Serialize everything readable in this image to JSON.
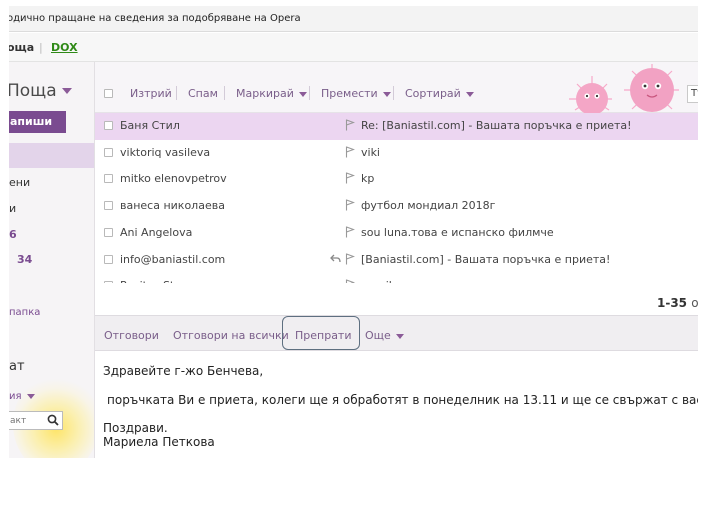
{
  "notice": {
    "text": "одично пращане на сведения за подобряване на Opera"
  },
  "product_bar": {
    "mail_label": "оща",
    "separator": "|",
    "dox_label": "DOX"
  },
  "sidebar": {
    "title": "Поща",
    "compose_label": "апиши",
    "items": [
      {
        "label": "ени"
      },
      {
        "label": "и"
      },
      {
        "label": "6"
      },
      {
        "label": "",
        "count": "34"
      }
    ],
    "new_folder_label": "папка",
    "chat_title": "ат",
    "status_label": "ия",
    "contact_search_placeholder": "акт"
  },
  "toolbar": {
    "delete_label": "Изтрий",
    "spam_label": "Спам",
    "mark_label": "Маркирай",
    "move_label": "Премести",
    "sort_label": "Сортирай",
    "search_text": "Тър"
  },
  "messages": [
    {
      "from": "Баня Стил",
      "subject": "Re: [Baniastil.com] - Вашата поръчка е приета!",
      "selected": true,
      "replied": false
    },
    {
      "from": "viktoriq vasileva",
      "subject": "viki",
      "selected": false,
      "replied": false
    },
    {
      "from": "mitko elenovpetrov",
      "subject": "kp",
      "selected": false,
      "replied": false
    },
    {
      "from": "ванеса николаева",
      "subject": "футбол мондиал 2018г",
      "selected": false,
      "replied": false
    },
    {
      "from": "Ani Angelova",
      "subject": "sou luna.това е испанско филмче",
      "selected": false,
      "replied": false
    },
    {
      "from": "info@baniastil.com",
      "subject": "[Baniastil.com] - Вашата поръчка е приета!",
      "selected": false,
      "replied": true
    },
    {
      "from": "Rositsa Stamenova",
      "subject": "pravila",
      "selected": false,
      "replied": false
    }
  ],
  "pagination": {
    "range": "1-35",
    "of": "от"
  },
  "reading_actions": {
    "reply_label": "Отговори",
    "reply_all_label": "Отговори на всички",
    "forward_label": "Препрати",
    "more_label": "Още"
  },
  "message_body": {
    "greeting": "Здравейте г-жо Бенчева,",
    "line1": "поръчката Ви е приета, колеги ще я обработят в понеделник на 13.11 и ще се свържат с вас за допълнителн",
    "closing": "Поздрави.",
    "signature": "Мариела Петкова"
  },
  "colors": {
    "accent": "#7a4b90",
    "selected_row": "#ecd6f1",
    "toolbar_text": "#7a5e8a",
    "dox_green": "#2f8a17"
  }
}
